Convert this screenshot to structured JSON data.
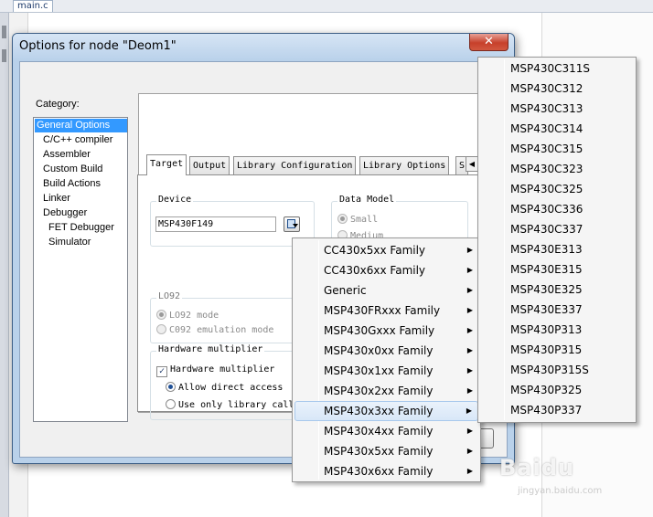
{
  "editor": {
    "tab_label": "main.c"
  },
  "dialog": {
    "title": "Options for node \"Deom1\"",
    "close_glyph": "✕",
    "category_label": "Category:",
    "categories": [
      "General Options",
      "C/C++ compiler",
      "Assembler",
      "Custom Build",
      "Build Actions",
      "Linker",
      "Debugger",
      "FET Debugger",
      "Simulator"
    ],
    "selected_category": "General Options",
    "tabs": [
      "Target",
      "Output",
      "Library Configuration",
      "Library Options",
      "S"
    ],
    "active_tab": "Target",
    "device": {
      "group_title": "Device",
      "value": "MSP430F149"
    },
    "data_model": {
      "group_title": "Data Model",
      "options": [
        "Small",
        "Medium"
      ],
      "selected": "Small"
    },
    "lo92": {
      "group_title": "LO92",
      "options": [
        "LO92 mode",
        "C092 emulation mode"
      ],
      "selected": "LO92 mode"
    },
    "hw_multiplier": {
      "group_title": "Hardware multiplier",
      "checkbox_label": "Hardware multiplier",
      "checked": true,
      "options": [
        "Allow direct access",
        "Use only library calls"
      ],
      "selected": "Allow direct access"
    }
  },
  "family_menu": {
    "items": [
      "CC430x5xx Family",
      "CC430x6xx Family",
      "Generic",
      "MSP430FRxxx Family",
      "MSP430Gxxx Family",
      "MSP430x0xx Family",
      "MSP430x1xx Family",
      "MSP430x2xx Family",
      "MSP430x3xx Family",
      "MSP430x4xx Family",
      "MSP430x5xx Family",
      "MSP430x6xx Family"
    ],
    "highlighted": "MSP430x3xx Family",
    "submenu_arrow": "▶"
  },
  "device_menu": {
    "items": [
      "MSP430C311S",
      "MSP430C312",
      "MSP430C313",
      "MSP430C314",
      "MSP430C315",
      "MSP430C323",
      "MSP430C325",
      "MSP430C336",
      "MSP430C337",
      "MSP430E313",
      "MSP430E315",
      "MSP430E325",
      "MSP430E337",
      "MSP430P313",
      "MSP430P315",
      "MSP430P315S",
      "MSP430P325",
      "MSP430P337"
    ]
  },
  "watermark": {
    "brand": "Baidu",
    "sub": "jingyan.baidu.com"
  }
}
